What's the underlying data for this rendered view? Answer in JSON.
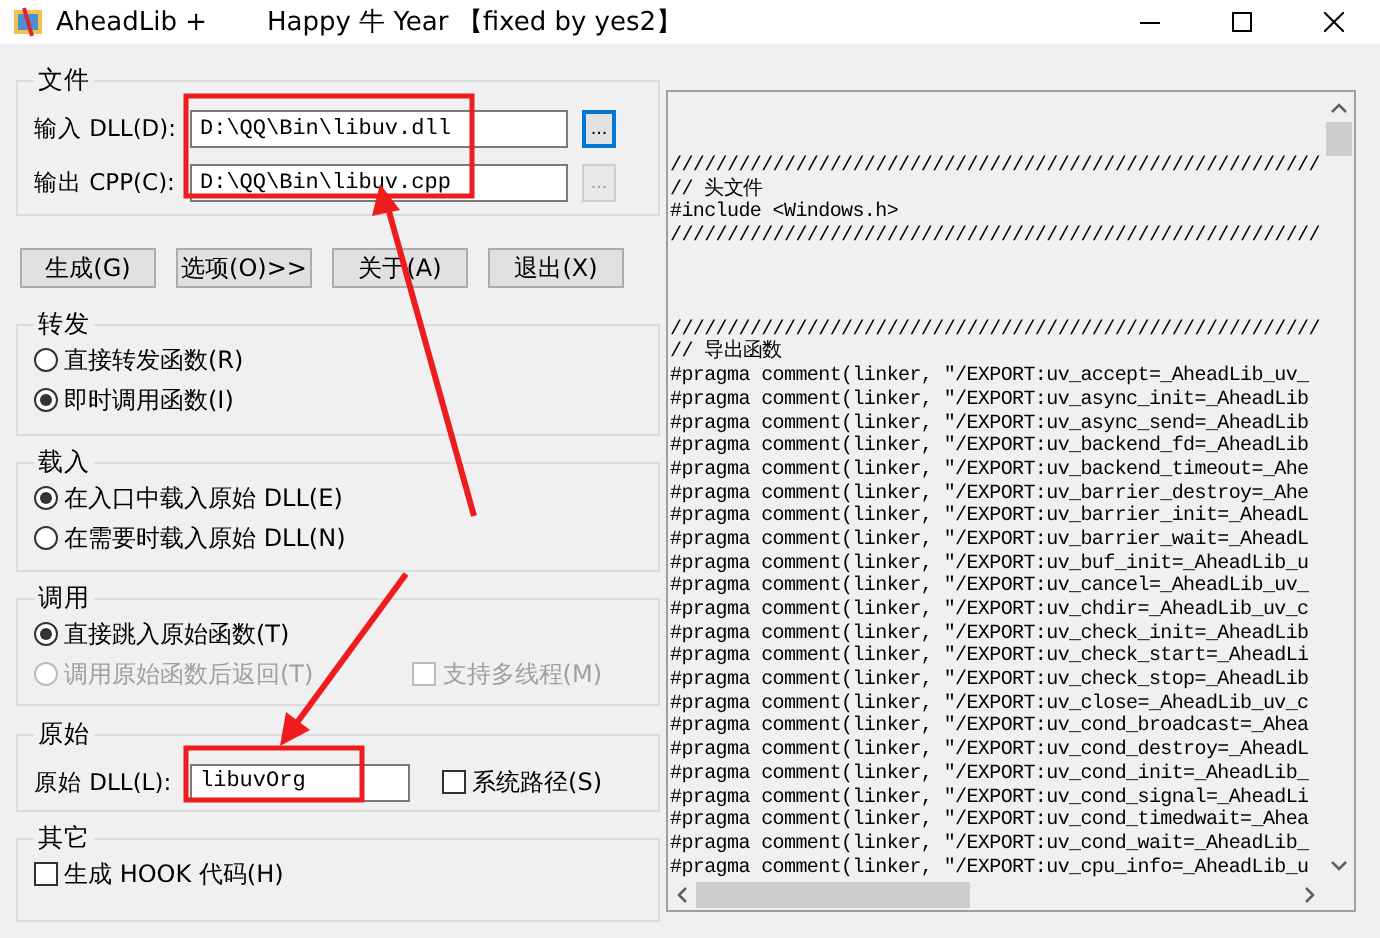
{
  "window": {
    "title": "AheadLib +",
    "subtitle": "Happy 牛 Year 【fixed by yes2】"
  },
  "file_group": {
    "title": "文件",
    "rows": [
      {
        "label": "输入 DLL(D):",
        "value": "D:\\QQ\\Bin\\libuv.dll",
        "browse": "...",
        "focused": true,
        "disabled": false
      },
      {
        "label": "输出 CPP(C):",
        "value": "D:\\QQ\\Bin\\libuv.cpp",
        "browse": "...",
        "focused": false,
        "disabled": true
      }
    ]
  },
  "buttons": [
    "生成(G)",
    "选项(O)>>",
    "关于(A)",
    "退出(X)"
  ],
  "groups": [
    {
      "title": "转发",
      "rows": [
        [
          {
            "kind": "radio",
            "label": "直接转发函数(R)",
            "checked": false,
            "disabled": false
          }
        ],
        [
          {
            "kind": "radio",
            "label": "即时调用函数(I)",
            "checked": true,
            "disabled": false
          }
        ]
      ]
    },
    {
      "title": "载入",
      "rows": [
        [
          {
            "kind": "radio",
            "label": "在入口中载入原始 DLL(E)",
            "checked": true,
            "disabled": false
          }
        ],
        [
          {
            "kind": "radio",
            "label": "在需要时载入原始 DLL(N)",
            "checked": false,
            "disabled": false
          }
        ]
      ]
    },
    {
      "title": "调用",
      "rows": [
        [
          {
            "kind": "radio",
            "label": "直接跳入原始函数(T)",
            "checked": true,
            "disabled": false
          }
        ],
        [
          {
            "kind": "radio",
            "label": "调用原始函数后返回(T)",
            "checked": false,
            "disabled": true
          },
          {
            "kind": "checkbox",
            "label": "支持多线程(M)",
            "checked": false,
            "disabled": true
          }
        ]
      ]
    },
    {
      "title": "原始",
      "rows": [
        [
          {
            "kind": "field",
            "label": "原始 DLL(L):",
            "value": "libuvOrg"
          },
          {
            "kind": "checkbox",
            "label": "系统路径(S)",
            "checked": false,
            "disabled": false
          }
        ]
      ]
    },
    {
      "title": "其它",
      "rows": [
        [
          {
            "kind": "checkbox",
            "label": "生成 HOOK 代码(H)",
            "checked": false,
            "disabled": false
          }
        ]
      ]
    }
  ],
  "code_blocks": [
    [
      "/////////////////////////////////////////////////////////",
      "// 头文件",
      "#include <Windows.h>",
      "/////////////////////////////////////////////////////////"
    ],
    [
      "/////////////////////////////////////////////////////////",
      "// 导出函数",
      "#pragma comment(linker, \"/EXPORT:uv_accept=_AheadLib_uv_",
      "#pragma comment(linker, \"/EXPORT:uv_async_init=_AheadLib",
      "#pragma comment(linker, \"/EXPORT:uv_async_send=_AheadLib",
      "#pragma comment(linker, \"/EXPORT:uv_backend_fd=_AheadLib",
      "#pragma comment(linker, \"/EXPORT:uv_backend_timeout=_Ahe",
      "#pragma comment(linker, \"/EXPORT:uv_barrier_destroy=_Ahe",
      "#pragma comment(linker, \"/EXPORT:uv_barrier_init=_AheadL",
      "#pragma comment(linker, \"/EXPORT:uv_barrier_wait=_AheadL",
      "#pragma comment(linker, \"/EXPORT:uv_buf_init=_AheadLib_u",
      "#pragma comment(linker, \"/EXPORT:uv_cancel=_AheadLib_uv_",
      "#pragma comment(linker, \"/EXPORT:uv_chdir=_AheadLib_uv_c",
      "#pragma comment(linker, \"/EXPORT:uv_check_init=_AheadLib",
      "#pragma comment(linker, \"/EXPORT:uv_check_start=_AheadLi",
      "#pragma comment(linker, \"/EXPORT:uv_check_stop=_AheadLib",
      "#pragma comment(linker, \"/EXPORT:uv_close=_AheadLib_uv_c",
      "#pragma comment(linker, \"/EXPORT:uv_cond_broadcast=_Ahea",
      "#pragma comment(linker, \"/EXPORT:uv_cond_destroy=_AheadL",
      "#pragma comment(linker, \"/EXPORT:uv_cond_init=_AheadLib_",
      "#pragma comment(linker, \"/EXPORT:uv_cond_signal=_AheadLi",
      "#pragma comment(linker, \"/EXPORT:uv_cond_timedwait=_Ahea",
      "#pragma comment(linker, \"/EXPORT:uv_cond_wait=_AheadLib_",
      "#pragma comment(linker, \"/EXPORT:uv_cpu_info=_AheadLib_u"
    ]
  ]
}
